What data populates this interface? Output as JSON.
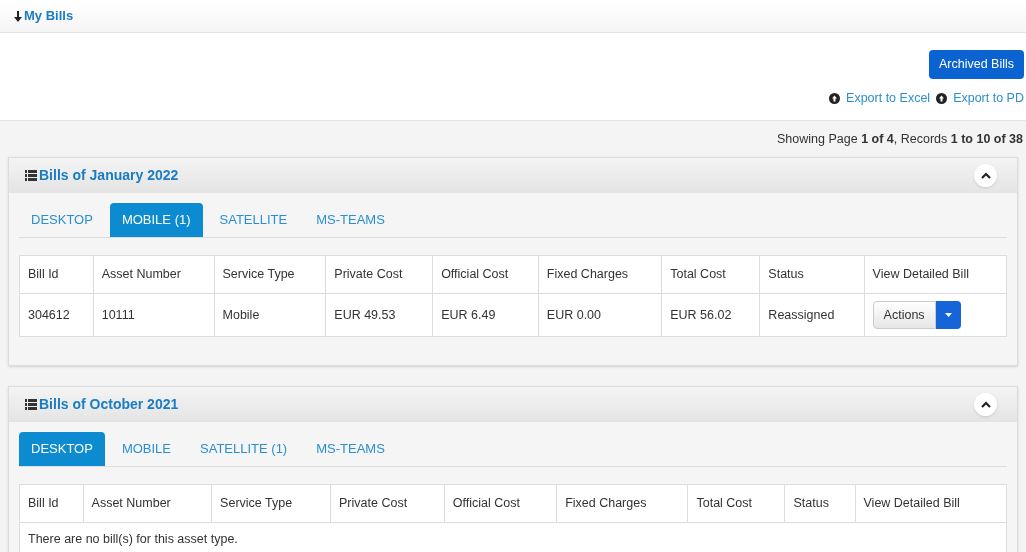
{
  "header": {
    "title": "My Bills"
  },
  "toolbar": {
    "archived_button": "Archived Bills",
    "exports": [
      "Export to Excel",
      "Export to PD"
    ]
  },
  "pagination": "Showing Page **1 of 4**, Records **1 to 10 of 38**",
  "panels": [
    {
      "title": "Bills of January 2022",
      "expanded": true,
      "tabs": [
        {
          "label": "DESKTOP",
          "selected": false
        },
        {
          "label": "MOBILE (1)",
          "selected": true
        },
        {
          "label": "SATELLITE",
          "selected": false
        },
        {
          "label": "MS-TEAMS",
          "selected": false
        }
      ],
      "columns": [
        "Bill Id",
        "Asset Number",
        "Service Type",
        "Private Cost",
        "Official Cost",
        "Fixed Charges",
        "Total Cost",
        "Status",
        "View Detailed Bill"
      ],
      "rows": [
        {
          "cells": [
            "304612",
            "10111",
            "Mobile",
            "EUR 49.53",
            "EUR 6.49",
            "EUR 0.00",
            "EUR 56.02",
            "Reassigned"
          ],
          "action": "Actions"
        }
      ]
    },
    {
      "title": "Bills of October 2021",
      "expanded": true,
      "tabs": [
        {
          "label": "DESKTOP",
          "selected": true
        },
        {
          "label": "MOBILE",
          "selected": false
        },
        {
          "label": "SATELLITE (1)",
          "selected": false
        },
        {
          "label": "MS-TEAMS",
          "selected": false
        }
      ],
      "columns": [
        "Bill Id",
        "Asset Number",
        "Service Type",
        "Private Cost",
        "Official Cost",
        "Fixed Charges",
        "Total Cost",
        "Status",
        "View Detailed Bill"
      ],
      "empty_message": "There are no bill(s) for this asset type."
    }
  ]
}
